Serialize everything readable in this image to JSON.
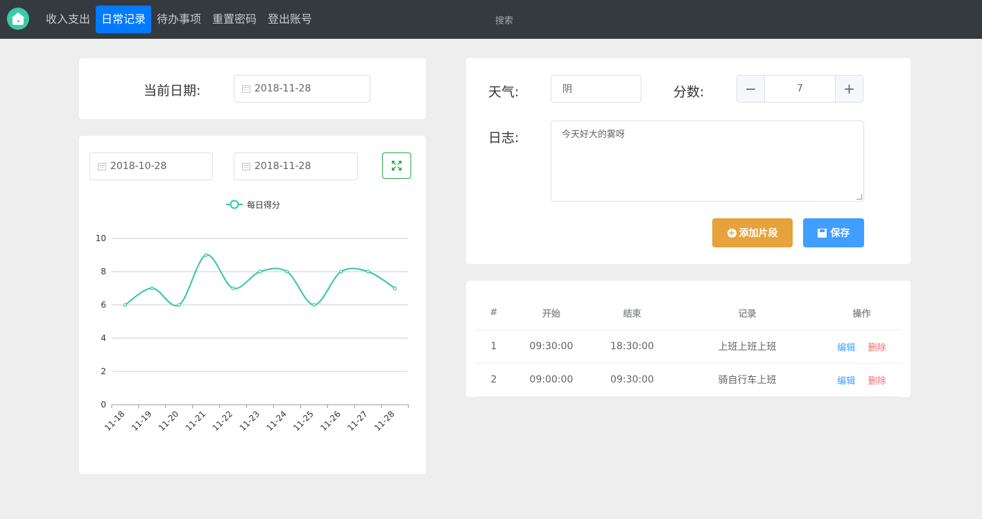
{
  "nav": {
    "items": [
      {
        "label": "收入支出",
        "active": false
      },
      {
        "label": "日常记录",
        "active": true
      },
      {
        "label": "待办事项",
        "active": false
      },
      {
        "label": "重置密码",
        "active": false
      },
      {
        "label": "登出账号",
        "active": false
      }
    ],
    "search_label": "搜索"
  },
  "date_card": {
    "label": "当前日期:",
    "date": "2018-11-28"
  },
  "chart_card": {
    "start_date": "2018-10-28",
    "end_date": "2018-11-28",
    "expand_icon": "expand-icon"
  },
  "entry_card": {
    "weather_label": "天气:",
    "weather_value": "阴",
    "score_label": "分数:",
    "score_value": "7",
    "minus_symbol": "−",
    "plus_symbol": "+",
    "log_label": "日志:",
    "log_text": "今天好大的雾呀",
    "add_button": "添加片段",
    "save_button": "保存"
  },
  "table": {
    "headers": [
      "#",
      "开始",
      "结束",
      "记录",
      "操作"
    ],
    "rows": [
      {
        "no": "1",
        "start": "09:30:00",
        "end": "18:30:00",
        "record": "上班上班上班",
        "edit": "编辑",
        "delete": "删除"
      },
      {
        "no": "2",
        "start": "09:00:00",
        "end": "09:30:00",
        "record": "骑自行车上班",
        "edit": "编辑",
        "delete": "删除"
      }
    ]
  },
  "colors": {
    "nav_bg": "#343a40",
    "active": "#007bff",
    "line": "#2ec7a0",
    "add_btn": "#e6a23c",
    "save_btn": "#409eff",
    "delete": "#f56c6c"
  },
  "chart_data": {
    "type": "line",
    "smooth": true,
    "legend": "每日得分",
    "legend_position": "top-center",
    "categories": [
      "11-18",
      "11-19",
      "11-20",
      "11-21",
      "11-22",
      "11-23",
      "11-24",
      "11-25",
      "11-26",
      "11-27",
      "11-28"
    ],
    "series": [
      {
        "name": "每日得分",
        "values": [
          6,
          7,
          6,
          9,
          7,
          8,
          8,
          6,
          8,
          8,
          7
        ]
      }
    ],
    "ylim": [
      0,
      10
    ],
    "yticks": [
      0,
      2,
      4,
      6,
      8,
      10
    ],
    "grid": true
  }
}
